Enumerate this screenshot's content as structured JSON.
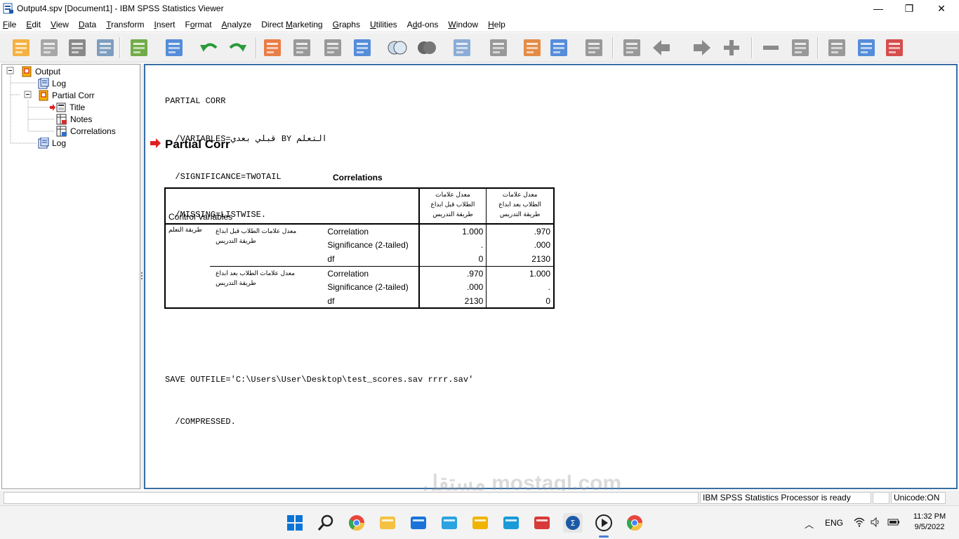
{
  "window": {
    "title": "Output4.spv [Document1] - IBM SPSS Statistics Viewer",
    "minimize": "—",
    "maximize": "❐",
    "close": "✕"
  },
  "menu": [
    {
      "label": "File",
      "key": "F"
    },
    {
      "label": "Edit",
      "key": "E"
    },
    {
      "label": "View",
      "key": "V"
    },
    {
      "label": "Data",
      "key": "D"
    },
    {
      "label": "Transform",
      "key": "T"
    },
    {
      "label": "Insert",
      "key": "I"
    },
    {
      "label": "Format",
      "key": "o"
    },
    {
      "label": "Analyze",
      "key": "A"
    },
    {
      "label": "Direct Marketing",
      "key": "M"
    },
    {
      "label": "Graphs",
      "key": "G"
    },
    {
      "label": "Utilities",
      "key": "U"
    },
    {
      "label": "Add-ons",
      "key": "d"
    },
    {
      "label": "Window",
      "key": "W"
    },
    {
      "label": "Help",
      "key": "H"
    }
  ],
  "toolbar_icons": [
    "open-icon",
    "save-icon",
    "print-icon",
    "print-preview-icon",
    "export-icon",
    "recall-dialog-icon",
    "undo-icon",
    "redo-icon",
    "goto-data-icon",
    "goto-case-icon",
    "goto-variable-icon",
    "variables-icon",
    "use-sets-icon",
    "show-all-variables-icon",
    "designate-window-icon",
    "create-title-icon",
    "insert-heading-icon",
    "insert-text-icon",
    "insert-output-icon",
    "select-last-output-icon",
    "previous-icon",
    "next-icon",
    "expand-icon",
    "collapse-icon",
    "show-icon",
    "hide-icon",
    "insert-new-heading-icon",
    "insert-new-title-icon",
    "insert-new-text-icon"
  ],
  "outline": {
    "root": "Output",
    "items": [
      {
        "label": "Log"
      },
      {
        "label": "Partial Corr"
      },
      {
        "label": "Title"
      },
      {
        "label": "Notes"
      },
      {
        "label": "Correlations"
      },
      {
        "label": "Log"
      }
    ]
  },
  "syntax1": [
    "PARTIAL CORR",
    "  /VARIABLES=قبلي بعدي BY التعلم",
    "  /SIGNIFICANCE=TWOTAIL",
    "  /MISSING=LISTWISE."
  ],
  "heading": "Partial Corr",
  "table": {
    "title": "Correlations",
    "control_header": "Control Variables",
    "col1_header": [
      "معدل علامات",
      "الطلاب قبل ابداع",
      "طريقة التدريس"
    ],
    "col2_header": [
      "معدل علامات",
      "الطلاب بعد ابداع",
      "طريقة التدريس"
    ],
    "control_var": "طريقة التعلم",
    "rows": [
      {
        "var": [
          "معدل علامات الطلاب قبل ابداع",
          "طريقة التدريس"
        ],
        "stats": [
          "Correlation",
          "Significance (2-tailed)",
          "df"
        ],
        "c1": [
          "1.000",
          ".",
          "0"
        ],
        "c2": [
          ".970",
          ".000",
          "2130"
        ]
      },
      {
        "var": [
          "معدل علامات الطلاب بعد ابداع",
          "طريقة التدريس"
        ],
        "stats": [
          "Correlation",
          "Significance (2-tailed)",
          "df"
        ],
        "c1": [
          ".970",
          ".000",
          "2130"
        ],
        "c2": [
          "1.000",
          ".",
          "0"
        ]
      }
    ]
  },
  "syntax2": [
    "SAVE OUTFILE='C:\\Users\\User\\Desktop\\test_scores.sav rrrr.sav'",
    "  /COMPRESSED."
  ],
  "status": {
    "processor": "IBM SPSS Statistics Processor is ready",
    "encoding": "Unicode:ON"
  },
  "watermark": "مستقل mostaql.com",
  "taskbar": {
    "apps": [
      "windows-start-icon",
      "search-icon",
      "chrome-icon",
      "file-explorer-icon",
      "mail-icon",
      "telegram-icon",
      "folder-app-icon",
      "edge-icon",
      "snipping-tool-icon",
      "spss-icon",
      "media-player-icon",
      "chrome-beta-icon"
    ],
    "language": "ENG",
    "time": "11:32 PM",
    "date": "9/5/2022"
  },
  "colors": {
    "accent_blue": "#3a6ea5",
    "arrow_red": "#e02020"
  }
}
